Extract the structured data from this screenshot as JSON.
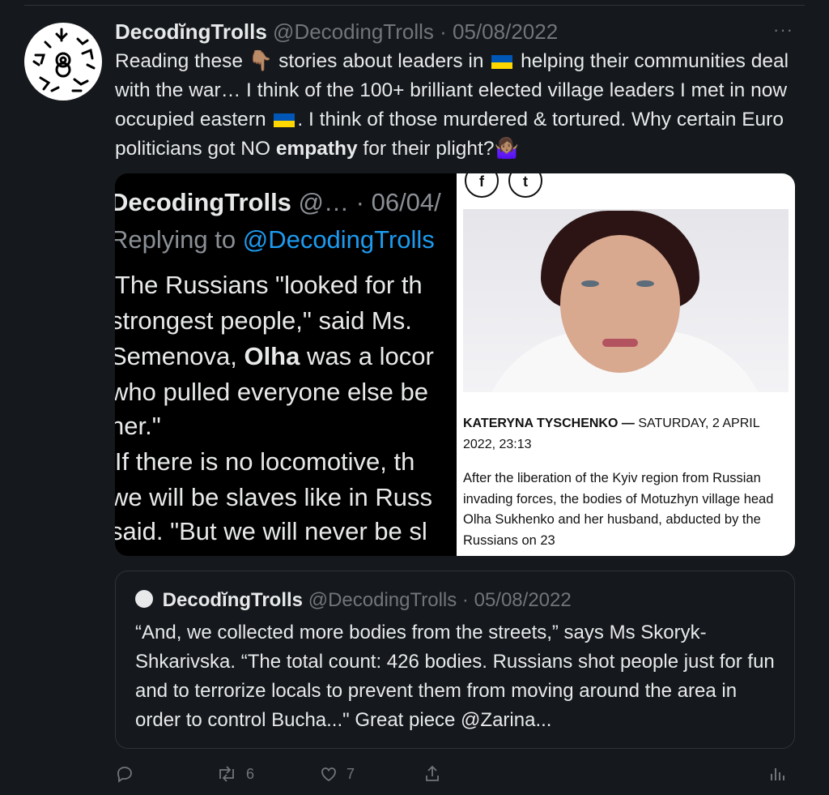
{
  "tweet": {
    "display_name": "DecodĭngTrolls",
    "handle": "@DecodingTrolls",
    "separator": "·",
    "date": "05/08/2022",
    "more_label": "···",
    "text": {
      "part1": "Reading these",
      "part2": "stories about leaders in",
      "part3": "helping their communities deal with the war… I think of the 100+ brilliant elected village leaders I met in now occupied eastern",
      "part4": ". I think of those murdered & tortured. Why certain Euro politicians got NO",
      "bold_word": "empathy",
      "part5": "for their plight?",
      "emoji_point": "👇🏽",
      "emoji_shrug": "🤷🏽‍♀️"
    },
    "flag_colors": {
      "blue": "#0057b7",
      "yellow": "#ffd700"
    }
  },
  "media_left": {
    "name": "DecodingTrolls",
    "handle_trunc": "@…",
    "date_trunc": "· 06/04/",
    "replying_prefix": "Replying to",
    "replying_handle": "@DecodingTrolls",
    "line1": "'The Russians \"looked for th",
    "line2": "strongest people,\" said Ms.",
    "line3a": "Semenova,",
    "line3_bold": "Olha",
    "line3b": "was a locor",
    "line4": "who pulled everyone else be",
    "line5": "her.\"",
    "line6": "'If there is no locomotive, th",
    "line7": "we will be slaves like in Russ",
    "line8": "said. \"But we will never be sl",
    "link_color": "#1d9bf0"
  },
  "media_right": {
    "social_f": "f",
    "social_t": "t",
    "author": "KATERYNA TYSCHENKO",
    "dash": "—",
    "date": "SATURDAY, 2 APRIL 2022, 23:13",
    "body": "After the liberation of the Kyiv region from Russian invading forces, the bodies of Motuzhyn village head Olha Sukhenko and her husband, abducted by the Russians on 23"
  },
  "quoted_tweet": {
    "display_name": "DecodĭngTrolls",
    "handle": "@DecodingTrolls",
    "separator": "·",
    "date": "05/08/2022",
    "text": "“And, we collected more bodies from the streets,” says Ms Skoryk-Shkarivska. “The total count: 426 bodies. Russians shot people just for fun and to terrorize locals to prevent them from moving around the area in order to control Bucha...\" Great piece @Zarina..."
  },
  "actions": {
    "reply_icon": "reply-icon",
    "retweet_count": "6",
    "like_count": "7",
    "share_icon": "share-icon",
    "analytics_icon": "analytics-icon"
  }
}
